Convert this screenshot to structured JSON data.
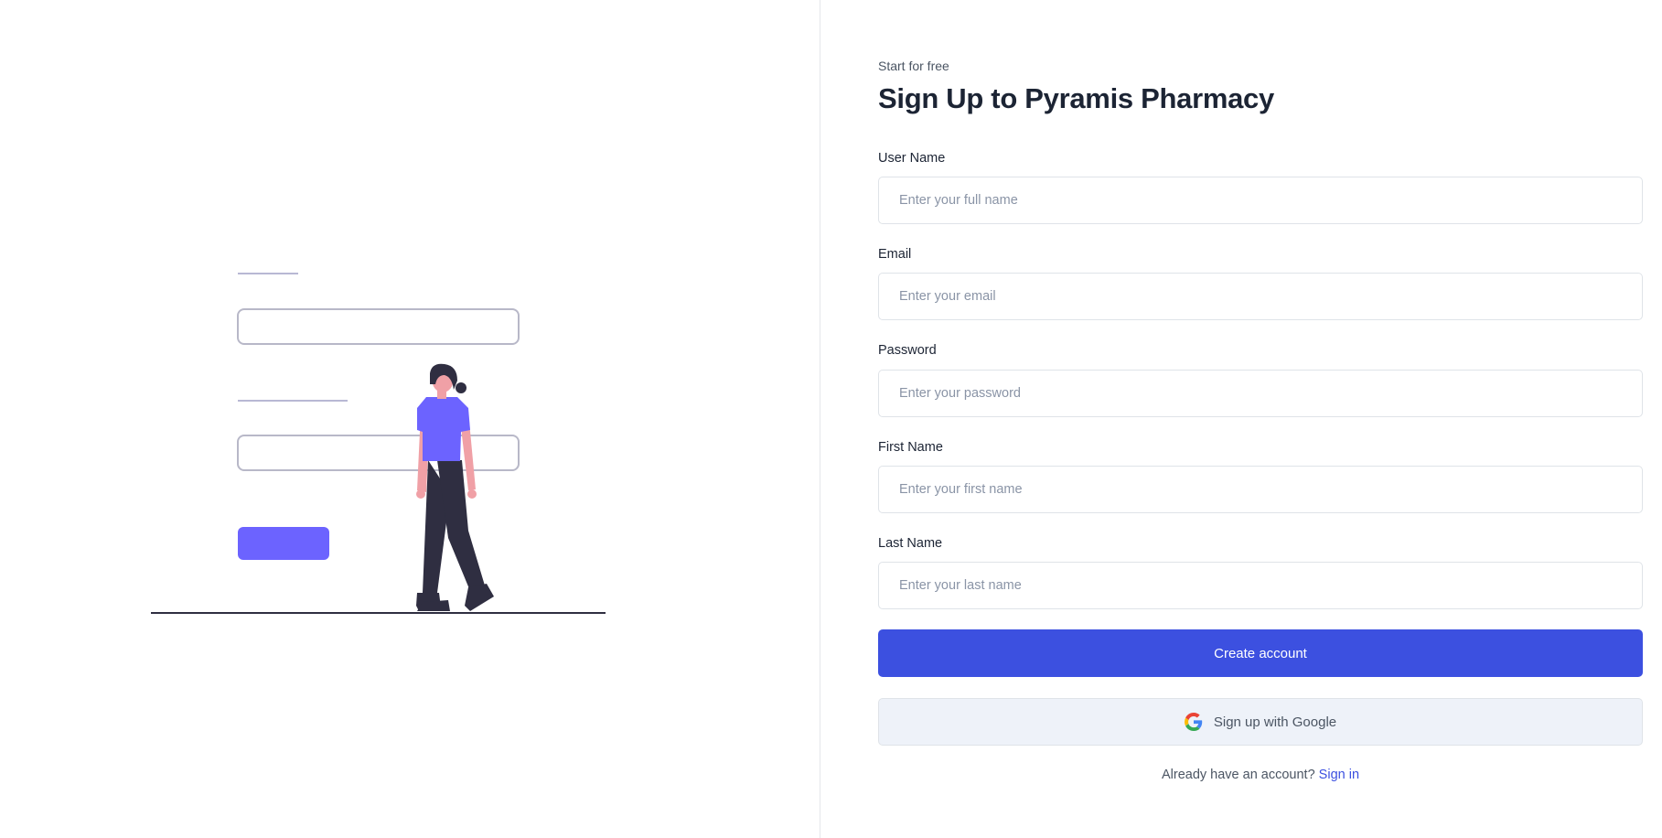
{
  "header": {
    "tagline": "Start for free",
    "title": "Sign Up to Pyramis Pharmacy"
  },
  "form": {
    "fields": [
      {
        "label": "User Name",
        "placeholder": "Enter your full name",
        "value": ""
      },
      {
        "label": "Email",
        "placeholder": "Enter your email",
        "value": ""
      },
      {
        "label": "Password",
        "placeholder": "Enter your password",
        "value": ""
      },
      {
        "label": "First Name",
        "placeholder": "Enter your first name",
        "value": ""
      },
      {
        "label": "Last Name",
        "placeholder": "Enter your last name",
        "value": ""
      }
    ],
    "submit_label": "Create account",
    "google_label": "Sign up with Google"
  },
  "footer": {
    "prompt": "Already have an account?",
    "signin_label": "Sign in"
  },
  "colors": {
    "primary": "#3c50e0",
    "illustration_accent": "#6c63ff",
    "heading": "#1c2434",
    "google_button_bg": "#eef2f9"
  },
  "icons": {
    "google": "google-icon"
  }
}
